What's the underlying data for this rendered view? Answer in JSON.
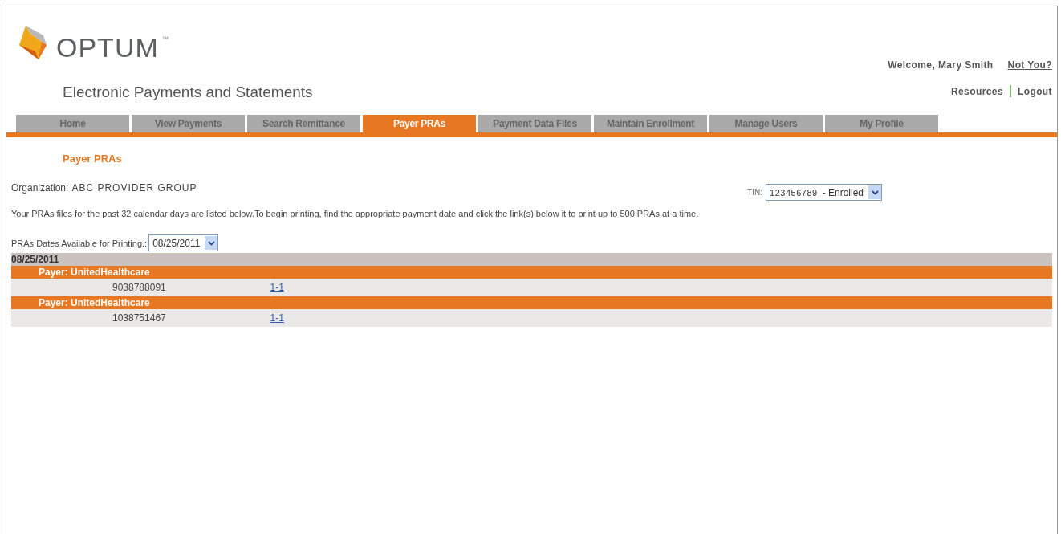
{
  "header": {
    "logo_text": "OPTUM",
    "trademark": "™",
    "subtitle": "Electronic Payments and Statements",
    "welcome": "Welcome, Mary Smith",
    "not_you": "Not You?",
    "links": [
      "Resources",
      "Logout"
    ]
  },
  "tabs": [
    {
      "label": "Home",
      "selected": false
    },
    {
      "label": "View Payments",
      "selected": false
    },
    {
      "label": "Search Remittance",
      "selected": false
    },
    {
      "label": "Payer PRAs",
      "selected": true
    },
    {
      "label": "Payment Data Files",
      "selected": false
    },
    {
      "label": "Maintain Enrollment",
      "selected": false
    },
    {
      "label": "Manage Users",
      "selected": false
    },
    {
      "label": "My Profile",
      "selected": false
    }
  ],
  "page": {
    "title": "Payer PRAs",
    "organization_label": "Organization:",
    "organization": "ABC PROVIDER GROUP",
    "tin_label": "TIN:",
    "tin_value": "123456789",
    "tin_status": "- Enrolled",
    "instructions": "Your PRAs files for the past 32 calendar days are listed below.To begin printing, find the appropriate payment date and click the link(s) below it to print up to 500 PRAs at a time.",
    "dates_label": "PRAs Dates Available for Printing.:",
    "dates_value": "08/25/2011"
  },
  "results": {
    "date": "08/25/2011",
    "groups": [
      {
        "payer": "Payer: UnitedHealthcare",
        "number": "9038788091",
        "link": "1-1"
      },
      {
        "payer": "Payer: UnitedHealthcare",
        "number": "1038751467",
        "link": "1-1"
      }
    ]
  }
}
